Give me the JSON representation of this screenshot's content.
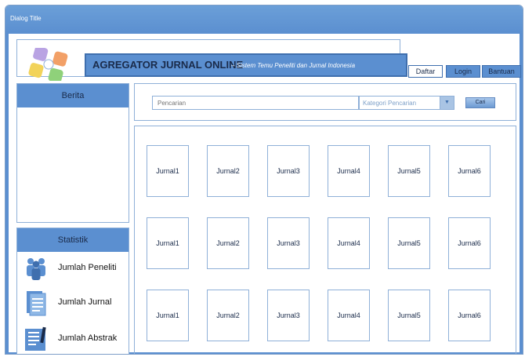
{
  "window": {
    "title": "Dialog Title"
  },
  "header": {
    "title": "AGREGATOR JURNAL ONLINE",
    "subtitle": "– Sistem Temu Peneliti dan Jurnal Indonesia",
    "tabs": [
      {
        "label": "Daftar"
      },
      {
        "label": "Login"
      },
      {
        "label": "Bantuan"
      }
    ]
  },
  "berita": {
    "title": "Berita"
  },
  "statistik": {
    "title": "Statistik",
    "items": [
      {
        "label": "Jumlah Peneliti",
        "icon": "people-icon"
      },
      {
        "label": "Jumlah Jurnal",
        "icon": "document-icon"
      },
      {
        "label": "Jumlah Abstrak",
        "icon": "abstract-document-icon"
      }
    ]
  },
  "search": {
    "placeholder": "Pencarian",
    "category_placeholder": "Kategori Pencarian",
    "button_label": "Cari"
  },
  "journals": {
    "rows": [
      [
        "Jurnal1",
        "Jurnal2",
        "Jurnal3",
        "Jurnal4",
        "Jurnal5",
        "Jurnal6"
      ],
      [
        "Jurnal1",
        "Jurnal2",
        "Jurnal3",
        "Jurnal4",
        "Jurnal5",
        "Jurnal6"
      ],
      [
        "Jurnal1",
        "Jurnal2",
        "Jurnal3",
        "Jurnal4",
        "Jurnal5",
        "Jurnal6"
      ]
    ]
  },
  "colors": {
    "accent": "#5b8fd0",
    "border": "#8fb0d8",
    "text": "#1a2b4a"
  }
}
